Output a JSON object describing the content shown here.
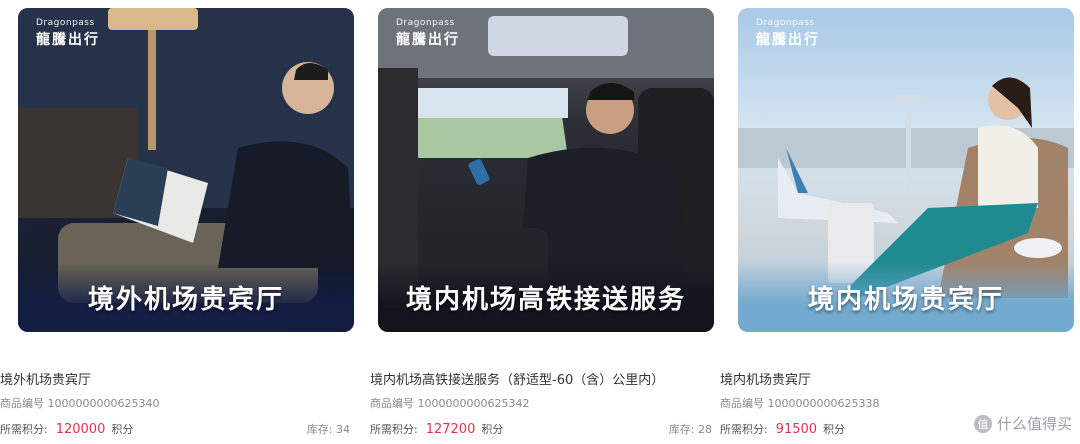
{
  "cards": [
    {
      "brand_en": "Dragonpass",
      "brand_zh": "龍騰出行",
      "banner_title": "境外机场贵宾厅",
      "name": "境外机场贵宾厅",
      "sku": "商品编号 1000000000625340",
      "price_label": "所需积分:",
      "price": "120000",
      "price_unit": "积分",
      "stock": "库存: 34"
    },
    {
      "brand_en": "Dragonpass",
      "brand_zh": "龍騰出行",
      "banner_title": "境内机场高铁接送服务",
      "name": "境内机场高铁接送服务（舒适型-60（含）公里内）",
      "sku": "商品编号 1000000000625342",
      "price_label": "所需积分:",
      "price": "127200",
      "price_unit": "积分",
      "stock": "库存: 28"
    },
    {
      "brand_en": "Dragonpass",
      "brand_zh": "龍騰出行",
      "banner_title": "境内机场贵宾厅",
      "name": "境内机场贵宾厅",
      "sku": "商品编号 1000000000625338",
      "price_label": "所需积分:",
      "price": "91500",
      "price_unit": "积分",
      "stock": ""
    }
  ],
  "watermark": {
    "text": "什么值得买",
    "icon": "值"
  },
  "colors": {
    "price": "#e0334c",
    "muted": "#8a8a8a",
    "text": "#333333"
  }
}
